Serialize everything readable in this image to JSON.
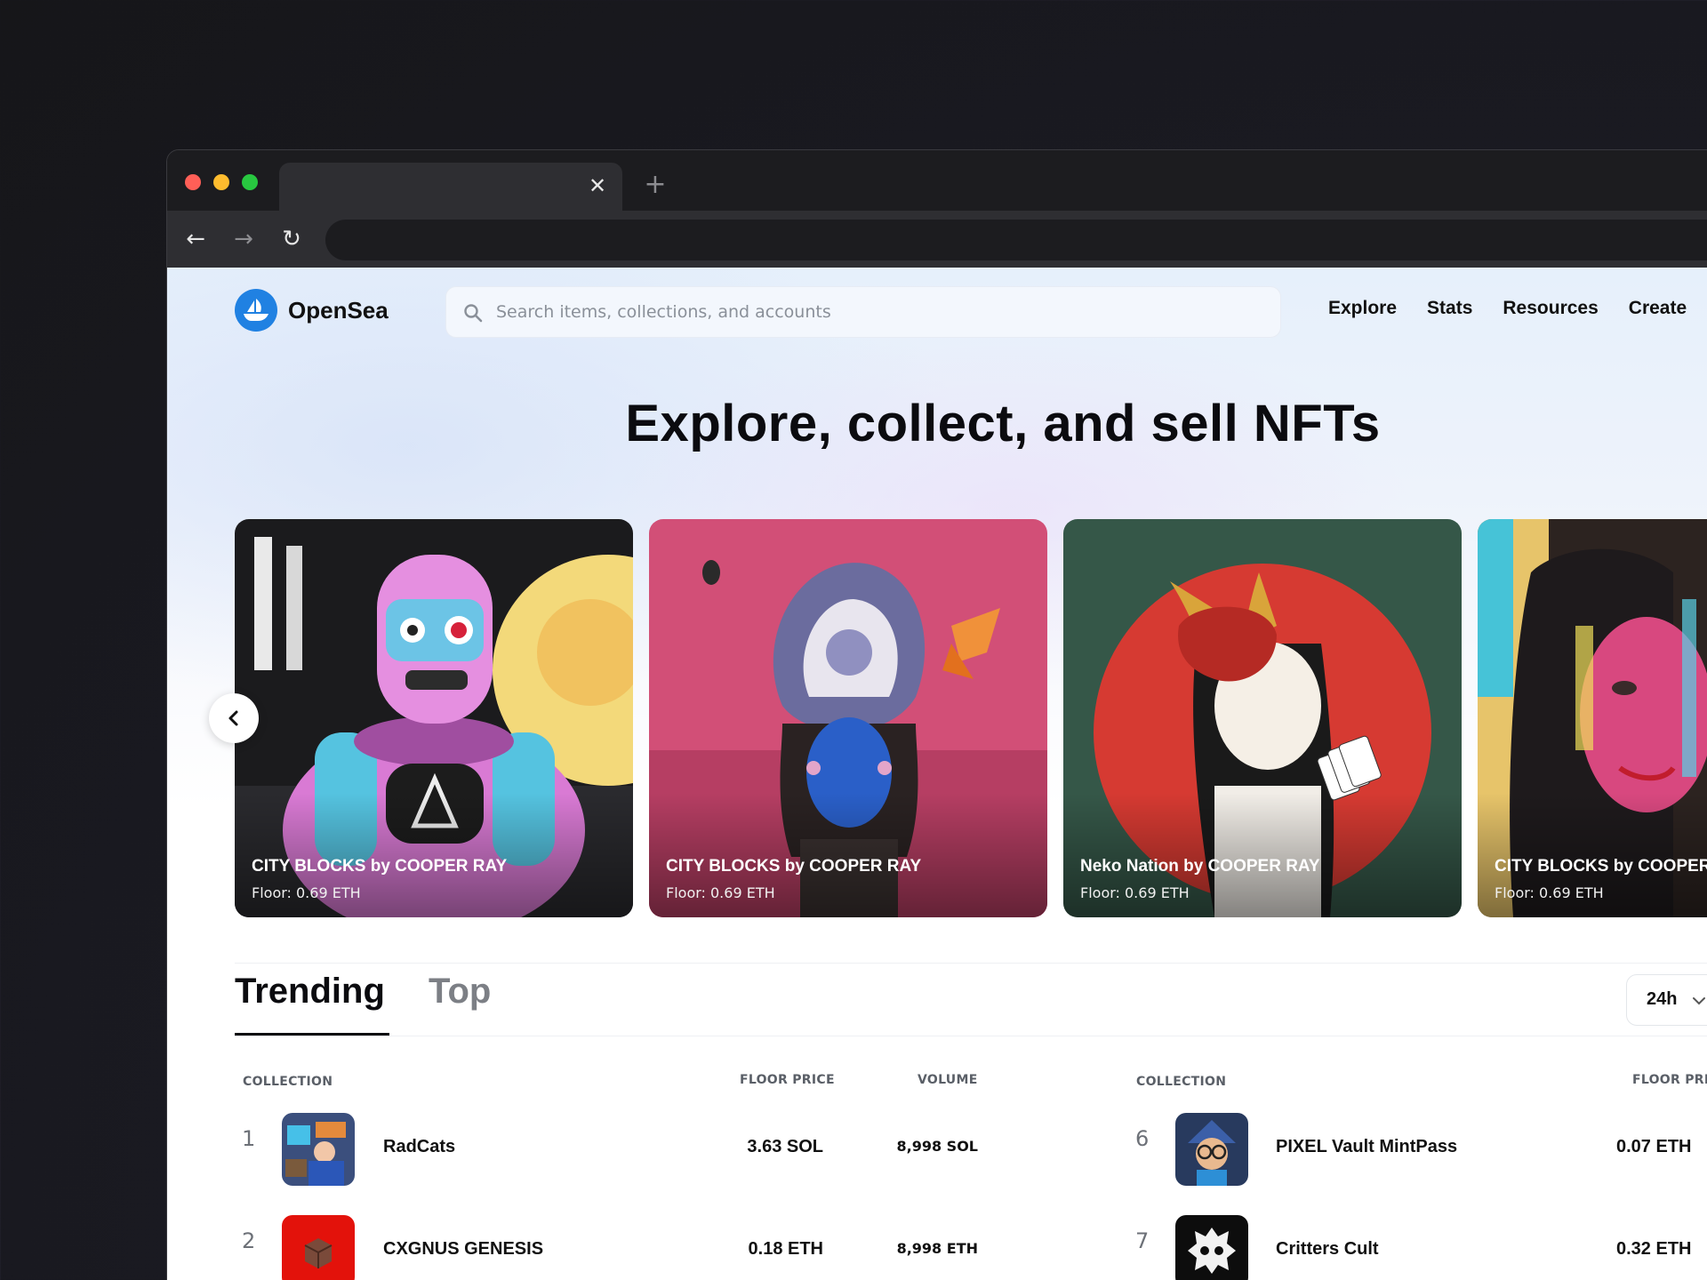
{
  "browser": {
    "tab_close_glyph": "✕",
    "new_tab_glyph": "+",
    "back_glyph": "←",
    "forward_glyph": "→",
    "reload_glyph": "↻"
  },
  "header": {
    "logo_text": "OpenSea",
    "search_placeholder": "Search items, collections, and accounts",
    "nav": [
      "Explore",
      "Stats",
      "Resources",
      "Create"
    ]
  },
  "hero": {
    "title": "Explore, collect, and sell NFTs"
  },
  "carousel": {
    "prev_glyph": "‹",
    "cards": [
      {
        "title": "CITY BLOCKS by COOPER RAY",
        "floor": "Floor: 0.69 ETH"
      },
      {
        "title": "CITY BLOCKS by COOPER RAY",
        "floor": "Floor: 0.69 ETH"
      },
      {
        "title": "Neko Nation by COOPER RAY",
        "floor": "Floor: 0.69 ETH"
      },
      {
        "title": "CITY BLOCKS by COOPER RAY",
        "floor": "Floor: 0.69 ETH"
      }
    ]
  },
  "rankings": {
    "tabs": [
      "Trending",
      "Top"
    ],
    "active_tab": "Trending",
    "range": "24h",
    "columns": {
      "collection": "COLLECTION",
      "floor": "FLOOR PRICE",
      "volume": "VOLUME"
    },
    "left_rows": [
      {
        "rank": "1",
        "name": "RadCats",
        "floor": "3.63 SOL",
        "volume": "8,998 SOL"
      },
      {
        "rank": "2",
        "name": "CXGNUS GENESIS",
        "floor": "0.18 ETH",
        "volume": "8,998 ETH"
      }
    ],
    "right_rows": [
      {
        "rank": "6",
        "name": "PIXEL Vault MintPass",
        "floor": "0.07 ETH"
      },
      {
        "rank": "7",
        "name": "Critters Cult",
        "floor": "0.32 ETH"
      }
    ]
  },
  "colors": {
    "brand": "#2081e2",
    "text": "#0b0b0f",
    "muted": "#7c7f85"
  }
}
